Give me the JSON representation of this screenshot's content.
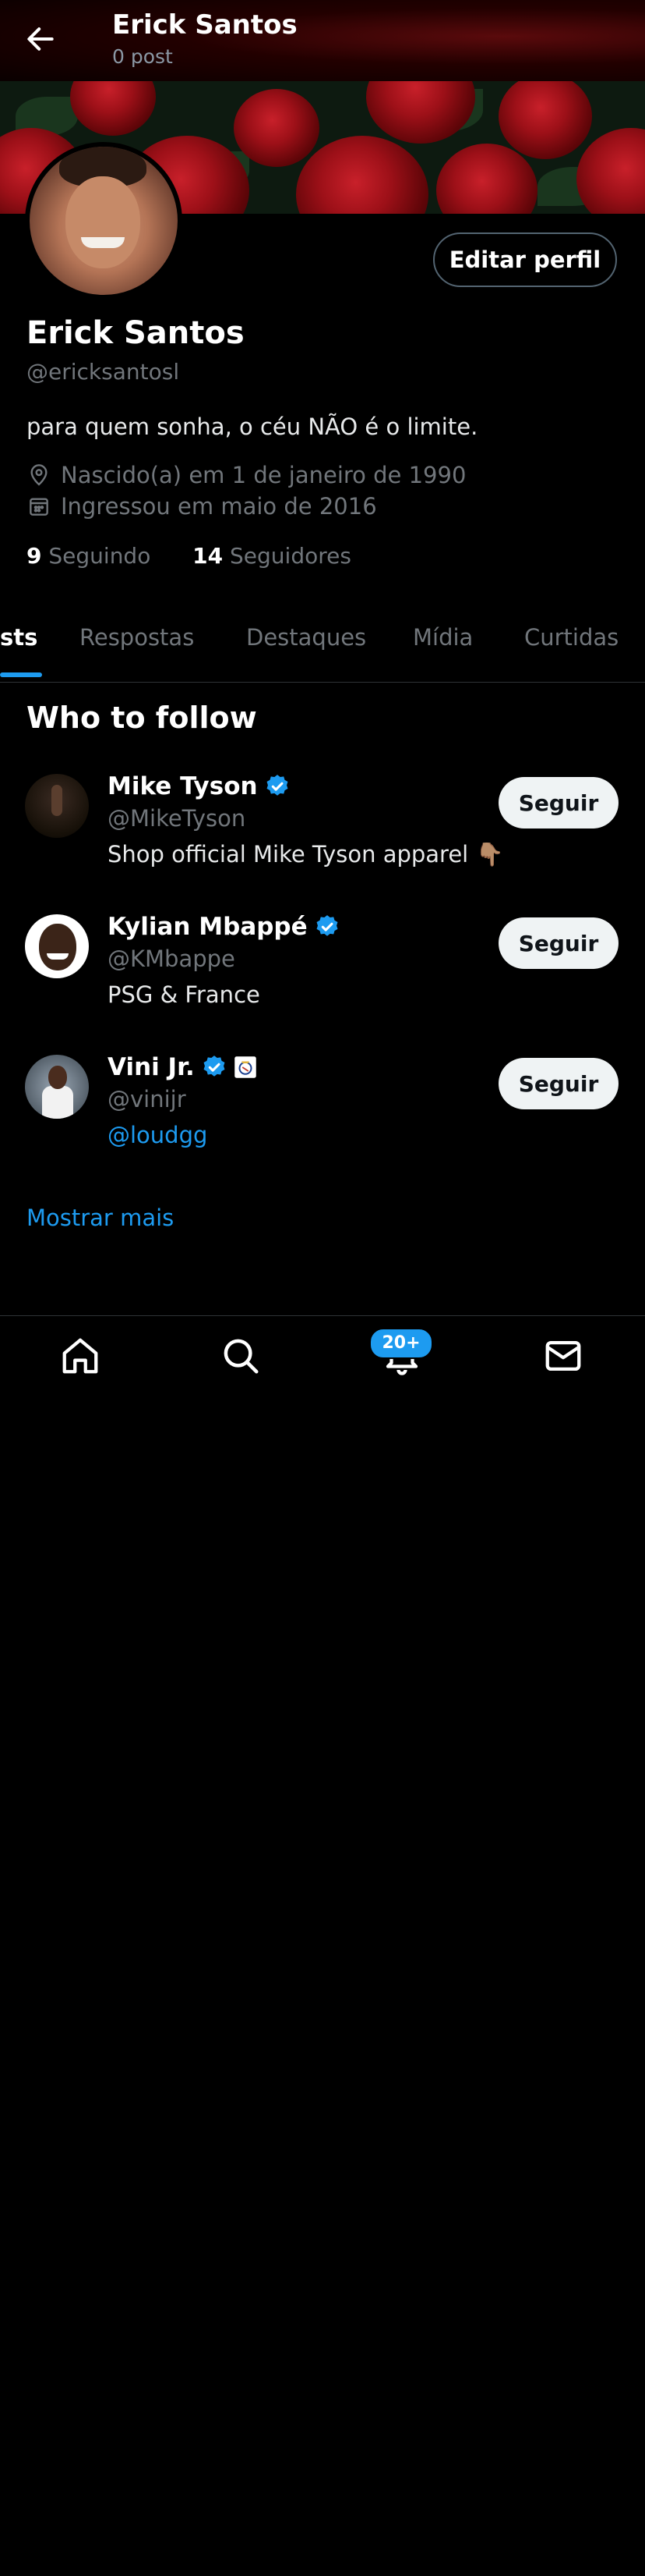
{
  "header": {
    "name": "Erick Santos",
    "posts": "0 post"
  },
  "profile": {
    "edit_button": "Editar perfil",
    "name": "Erick Santos",
    "handle": "@ericksantosl",
    "bio": "para quem sonha, o céu NÃO é o limite.",
    "born": "Nascido(a) em 1 de janeiro de 1990",
    "joined": "Ingressou em maio de 2016",
    "following_count": "9",
    "following_label": "Seguindo",
    "followers_count": "14",
    "followers_label": "Seguidores"
  },
  "tabs": [
    "sts",
    "Respostas",
    "Destaques",
    "Mídia",
    "Curtidas"
  ],
  "who_to_follow": {
    "title": "Who to follow",
    "items": [
      {
        "name": "Mike Tyson",
        "handle": "@MikeTyson",
        "description": "Shop official Mike Tyson apparel 👇🏽",
        "button": "Seguir"
      },
      {
        "name": "Kylian Mbappé",
        "handle": "@KMbappe",
        "description": "PSG & France",
        "button": "Seguir"
      },
      {
        "name": "Vini Jr.",
        "handle": "@vinijr",
        "description": "@loudgg",
        "button": "Seguir"
      }
    ],
    "show_more": "Mostrar mais"
  },
  "bottom_nav": {
    "badge": "20+"
  },
  "colors": {
    "accent": "#1d9bf0",
    "background": "#000000",
    "muted": "#71767b"
  }
}
